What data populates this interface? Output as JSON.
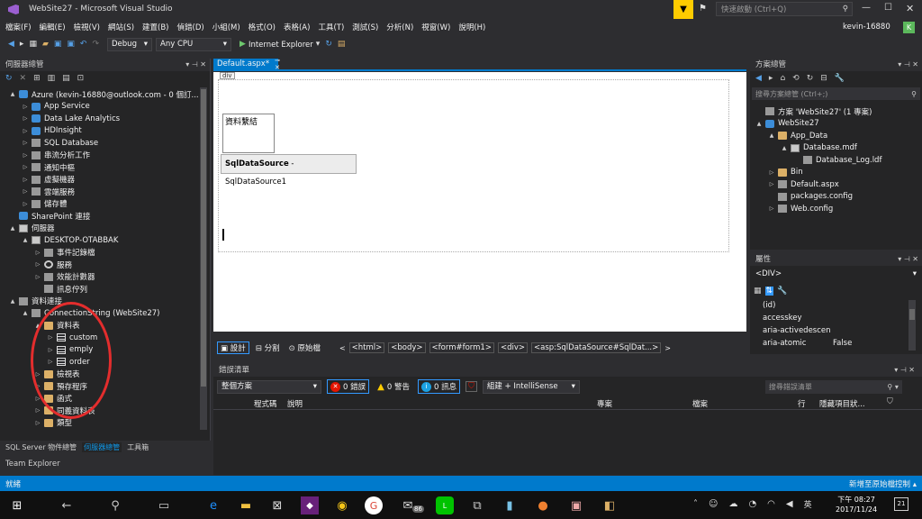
{
  "window": {
    "title": "WebSite27 - Microsoft Visual Studio",
    "quick_launch_placeholder": "快速啟動 (Ctrl+Q)",
    "user": "kevin-16880",
    "avatar_letter": "K"
  },
  "menu": [
    "檔案(F)",
    "編輯(E)",
    "檢視(V)",
    "網站(S)",
    "建置(B)",
    "偵錯(D)",
    "小組(M)",
    "格式(O)",
    "表格(A)",
    "工具(T)",
    "測試(S)",
    "分析(N)",
    "視窗(W)",
    "說明(H)"
  ],
  "toolbar": {
    "config": "Debug",
    "platform": "Any CPU",
    "run_label": "Internet Explorer"
  },
  "server_explorer": {
    "title": "伺服器總管",
    "tree": [
      {
        "level": 0,
        "exp": "▲",
        "icon": "blueico",
        "label": "Azure (kevin-16880@outlook.com - 0 個訂..."
      },
      {
        "level": 1,
        "exp": "▷",
        "icon": "blueico",
        "label": "App Service"
      },
      {
        "level": 1,
        "exp": "▷",
        "icon": "blueico",
        "label": "Data Lake Analytics"
      },
      {
        "level": 1,
        "exp": "▷",
        "icon": "blueico",
        "label": "HDInsight"
      },
      {
        "level": 1,
        "exp": "▷",
        "icon": "sq",
        "label": "SQL Database"
      },
      {
        "level": 1,
        "exp": "▷",
        "icon": "sq",
        "label": "串流分析工作"
      },
      {
        "level": 1,
        "exp": "▷",
        "icon": "sq",
        "label": "通知中樞"
      },
      {
        "level": 1,
        "exp": "▷",
        "icon": "sq",
        "label": "虛擬機器"
      },
      {
        "level": 1,
        "exp": "▷",
        "icon": "sq",
        "label": "雲端服務"
      },
      {
        "level": 1,
        "exp": "▷",
        "icon": "sq",
        "label": "儲存體"
      },
      {
        "level": 0,
        "exp": "",
        "icon": "blueico",
        "label": "SharePoint 連接"
      },
      {
        "level": 0,
        "exp": "▲",
        "icon": "srv",
        "label": "伺服器"
      },
      {
        "level": 1,
        "exp": "▲",
        "icon": "srv",
        "label": "DESKTOP-OTABBAK"
      },
      {
        "level": 2,
        "exp": "▷",
        "icon": "sq",
        "label": "事件記錄檔"
      },
      {
        "level": 2,
        "exp": "▷",
        "icon": "gear",
        "label": "服務"
      },
      {
        "level": 2,
        "exp": "▷",
        "icon": "sq",
        "label": "效能計數器"
      },
      {
        "level": 2,
        "exp": "",
        "icon": "sq",
        "label": "訊息佇列"
      },
      {
        "level": 0,
        "exp": "▲",
        "icon": "sq",
        "label": "資料連接"
      },
      {
        "level": 1,
        "exp": "▲",
        "icon": "sq",
        "label": "ConnectionString (WebSite27)"
      },
      {
        "level": 2,
        "exp": "▲",
        "icon": "folder",
        "label": "資料表"
      },
      {
        "level": 3,
        "exp": "▷",
        "icon": "tbl",
        "label": "custom"
      },
      {
        "level": 3,
        "exp": "▷",
        "icon": "tbl",
        "label": "emply"
      },
      {
        "level": 3,
        "exp": "▷",
        "icon": "tbl",
        "label": "order"
      },
      {
        "level": 2,
        "exp": "▷",
        "icon": "folder",
        "label": "檢視表"
      },
      {
        "level": 2,
        "exp": "▷",
        "icon": "folder",
        "label": "預存程序"
      },
      {
        "level": 2,
        "exp": "▷",
        "icon": "folder",
        "label": "函式"
      },
      {
        "level": 2,
        "exp": "▷",
        "icon": "folder",
        "label": "同義資料表"
      },
      {
        "level": 2,
        "exp": "▷",
        "icon": "folder",
        "label": "類型"
      }
    ],
    "bottom_tabs": [
      "SQL Server 物件總管",
      "伺服器總管",
      "工具箱"
    ],
    "team_explorer": "Team Explorer"
  },
  "editor": {
    "tab": "Default.aspx*",
    "div_tag": "div",
    "label_text": "資料繫結",
    "datasource_bold": "SqlDataSource",
    "datasource_rest": " - SqlDataSource1",
    "view_tabs": [
      "設計",
      "分割",
      "原始檔"
    ],
    "breadcrumbs": [
      "<html>",
      "<body>",
      "<form#form1>",
      "<div>",
      "<asp:SqlDataSource#SqlDat...>"
    ]
  },
  "solution": {
    "title": "方案總管",
    "search_placeholder": "搜尋方案總管 (Ctrl+;)",
    "tree": [
      {
        "level": 0,
        "exp": "",
        "icon": "sq",
        "label": "方案 'WebSite27' (1 專案)"
      },
      {
        "level": 0,
        "exp": "▲",
        "icon": "blueico",
        "label": "WebSite27"
      },
      {
        "level": 1,
        "exp": "▲",
        "icon": "folder",
        "label": "App_Data"
      },
      {
        "level": 2,
        "exp": "▲",
        "icon": "srv",
        "label": "Database.mdf"
      },
      {
        "level": 3,
        "exp": "",
        "icon": "sq",
        "label": "Database_Log.ldf"
      },
      {
        "level": 1,
        "exp": "▷",
        "icon": "folder",
        "label": "Bin"
      },
      {
        "level": 1,
        "exp": "▷",
        "icon": "sq",
        "label": "Default.aspx"
      },
      {
        "level": 1,
        "exp": "",
        "icon": "sq",
        "label": "packages.config"
      },
      {
        "level": 1,
        "exp": "▷",
        "icon": "sq",
        "label": "Web.config"
      }
    ]
  },
  "properties": {
    "title": "屬性",
    "object": "<DIV>",
    "rows": [
      [
        "(id)",
        ""
      ],
      [
        "accesskey",
        ""
      ],
      [
        "aria-activedescen",
        ""
      ],
      [
        "aria-atomic",
        "False"
      ]
    ]
  },
  "error_list": {
    "title": "錯誤清單",
    "scope": "整個方案",
    "errors": "0 錯誤",
    "warnings": "0 警告",
    "messages": "0 訊息",
    "build": "組建 + IntelliSense",
    "search_placeholder": "搜尋錯誤清單",
    "columns": [
      "程式碼",
      "說明",
      "專案",
      "檔案",
      "行",
      "隱藏項目狀..."
    ]
  },
  "status": {
    "left": "就緒",
    "right": "新增至原始檔控制"
  },
  "taskbar": {
    "time": "下午 08:27",
    "date": "2017/11/24",
    "lang": "英",
    "badge": "86",
    "notif": "21"
  }
}
